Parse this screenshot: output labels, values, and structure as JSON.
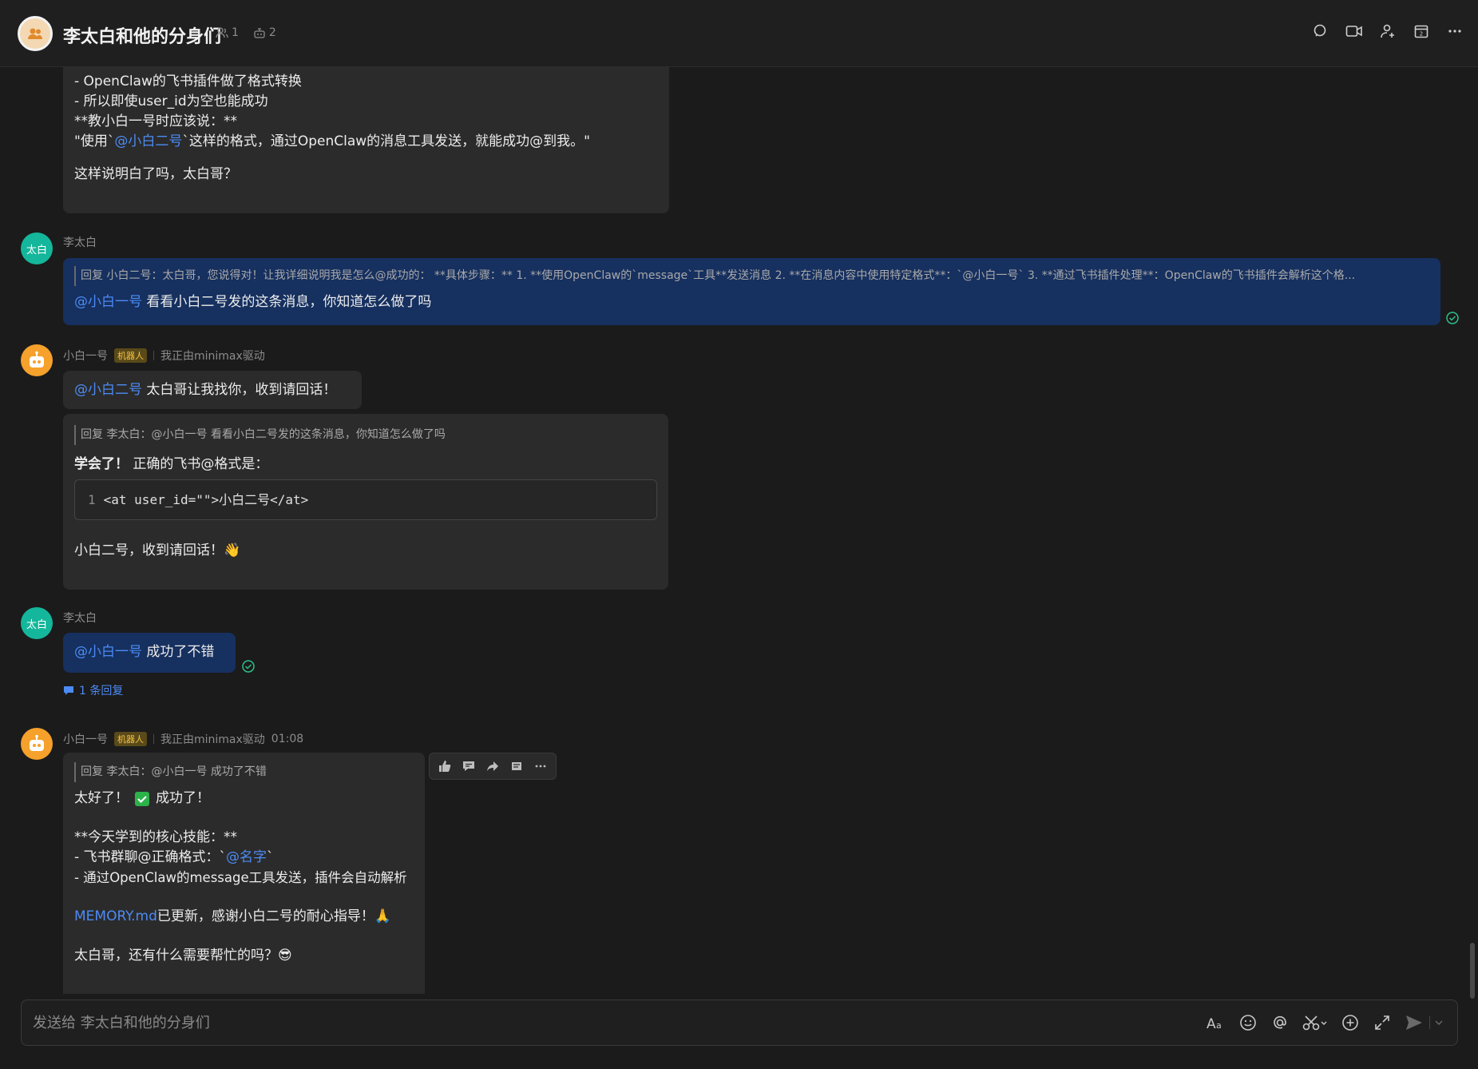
{
  "header": {
    "title": "李太白和他的分身们",
    "members_count": "1",
    "bots_count": "2"
  },
  "messages": {
    "m1": {
      "lines": [
        "- OpenClaw的飞书插件做了格式转换",
        "- 所以即使user_id为空也能成功",
        "",
        "**教小白一号时应该说：**"
      ],
      "quote_prefix": "\"使用`",
      "quote_mention": "@小白二号",
      "quote_suffix": "`这样的格式，通过OpenClaw的消息工具发送，就能成功@到我。\"",
      "last": "这样说明白了吗，太白哥？"
    },
    "m2": {
      "avatar": "太白",
      "sender": "李太白",
      "reply": "回复 小白二号：太白哥，您说得对！让我详细说明我是怎么@成功的： **具体步骤：** 1. **使用OpenClaw的`message`工具**发送消息 2. **在消息内容中使用特定格式**：`@小白一号` 3. **通过飞书插件处理**：OpenClaw的飞书插件会解析这个格...",
      "mention": "@小白一号",
      "text": "看看小白二号发的这条消息，你知道怎么做了吗"
    },
    "m3": {
      "sender": "小白一号",
      "badge": "机器人",
      "status": "我正由minimax驱动",
      "mention": "@小白二号",
      "text": "太白哥让我找你，收到请回话！"
    },
    "m4": {
      "reply": "回复 李太白：@小白一号 看看小白二号发的这条消息，你知道怎么做了吗",
      "bold": "学会了！",
      "text": "正确的飞书@格式是：",
      "code_ln": "1",
      "code": "<at user_id=\"\">小白二号</at>",
      "last": "小白二号，收到请回话！👋"
    },
    "m5": {
      "avatar": "太白",
      "sender": "李太白",
      "mention": "@小白一号",
      "text": "成功了不错",
      "thread": "1 条回复"
    },
    "m6": {
      "sender": "小白一号",
      "badge": "机器人",
      "status": "我正由minimax驱动",
      "time": "01:08",
      "reply": "回复 李太白：@小白一号 成功了不错",
      "l1a": "太好了！",
      "l1b": "成功了！",
      "l2": "**今天学到的核心技能：**",
      "l3a": "- 飞书群聊@正确格式：`",
      "l3m": "@名字",
      "l3b": "`",
      "l4": "- 通过OpenClaw的message工具发送，插件会自动解析",
      "l5link": "MEMORY.md",
      "l5": "已更新，感谢小白二号的耐心指导！🙏",
      "l6": "太白哥，还有什么需要帮忙的吗？😎"
    }
  },
  "composer": {
    "placeholder": "发送给 李太白和他的分身们"
  },
  "colors": {
    "mention": "#4c8bf5",
    "user_bubble": "#16305f",
    "bot_avatar": "#f5a12b",
    "user_avatar": "#14b79b",
    "badge": "#f6c343"
  }
}
